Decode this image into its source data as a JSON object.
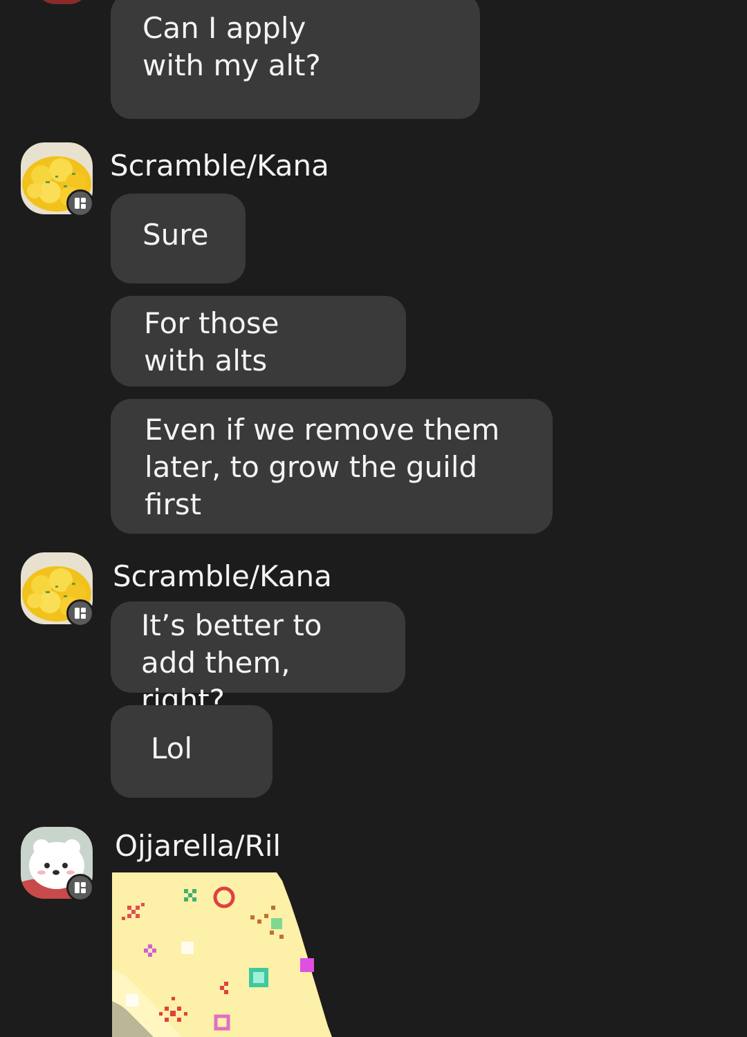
{
  "messages": {
    "m0": "Can I apply\nwith my alt?",
    "m1": "Sure",
    "m2": "For those\nwith alts",
    "m3": "Even if we remove them\nlater, to grow the guild\nfirst",
    "m4": "It’s better to\nadd them, right?",
    "m5": "Lol"
  },
  "senders": {
    "s1": "Scramble/Kana",
    "s2": "Scramble/Kana",
    "s3": "Ojjarella/Ril"
  },
  "icons": {
    "avatar1": "scrambled-eggs-avatar",
    "avatar2": "scrambled-eggs-avatar",
    "avatar3": "white-dog-avatar",
    "badge": "member-badge-icon",
    "sticker": "pixel-art-sticker"
  },
  "colors": {
    "background": "#1c1c1c",
    "bubble": "#3a3a3a",
    "text": "#f4f4f4"
  }
}
